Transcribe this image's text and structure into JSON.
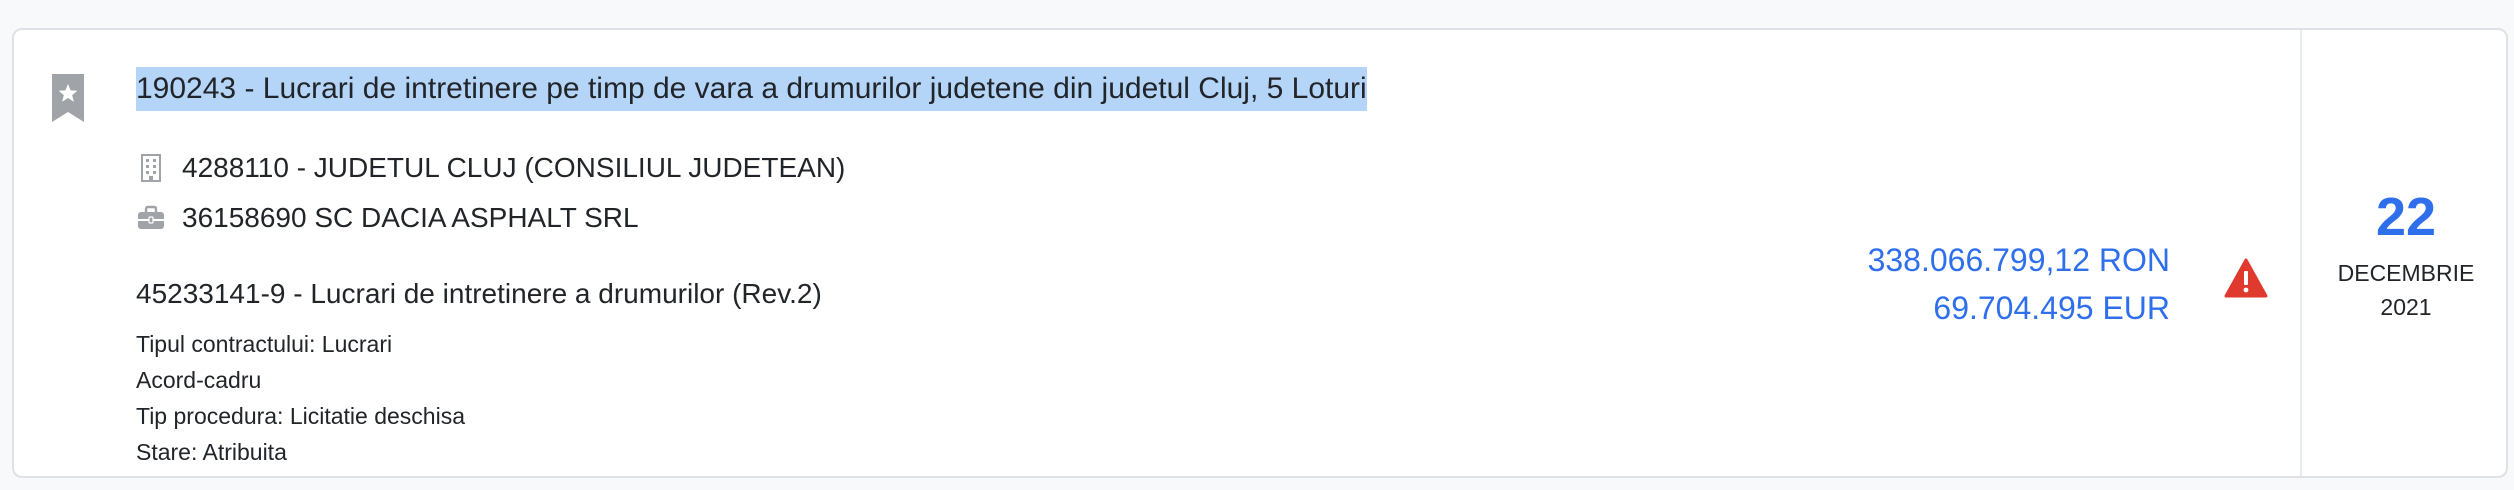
{
  "tender": {
    "title": "190243 - Lucrari de intretinere pe timp de vara a drumurilor judetene din judetul Cluj, 5 Loturi",
    "authority": "4288110 - JUDETUL CLUJ (CONSILIUL JUDETEAN)",
    "winner": "36158690 SC DACIA ASPHALT SRL",
    "cpv": "45233141-9 - Lucrari de intretinere a drumurilor (Rev.2)",
    "contract_type": "Tipul contractului: Lucrari",
    "agreement": "Acord-cadru",
    "procedure": "Tip procedura: Licitatie deschisa",
    "status": "Stare: Atribuita"
  },
  "value": {
    "ron": "338.066.799,12 RON",
    "eur": "69.704.495 EUR"
  },
  "date": {
    "day": "22",
    "month": "DECEMBRIE",
    "year": "2021"
  },
  "icons": {
    "bookmark": "bookmark-star-icon",
    "authority": "building-icon",
    "winner": "briefcase-icon",
    "warning": "warning-icon"
  },
  "colors": {
    "accent": "#2f6fec",
    "warning": "#e03a2f",
    "icon_gray": "#a0a4a8",
    "title_highlight": "#b4d5f8"
  }
}
